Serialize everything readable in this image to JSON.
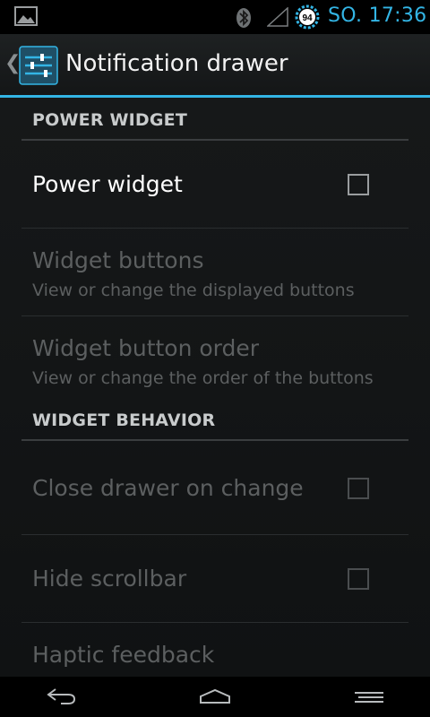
{
  "status_bar": {
    "time": "SO. 17:36",
    "battery_level": "94",
    "accent_color": "#33b5e5",
    "icons": [
      "gallery-icon",
      "bluetooth-icon",
      "signal-icon",
      "battery-icon"
    ]
  },
  "action_bar": {
    "title": "Notification drawer",
    "up_glyph": "❮",
    "app_icon": "settings-sliders-icon"
  },
  "sections": [
    {
      "header": "POWER WIDGET",
      "items": [
        {
          "title": "Power widget",
          "checked": false,
          "enabled": true
        },
        {
          "title": "Widget buttons",
          "summary": "View or change the displayed buttons",
          "enabled": false
        },
        {
          "title": "Widget button order",
          "summary": "View or change the order of the buttons",
          "enabled": false
        }
      ]
    },
    {
      "header": "WIDGET BEHAVIOR",
      "items": [
        {
          "title": "Close drawer on change",
          "checked": false,
          "enabled": false
        },
        {
          "title": "Hide scrollbar",
          "checked": false,
          "enabled": false
        },
        {
          "title": "Haptic feedback",
          "enabled": false
        }
      ]
    }
  ],
  "nav_bar": {
    "icons": [
      "back-icon",
      "home-icon",
      "recents-icon"
    ]
  }
}
